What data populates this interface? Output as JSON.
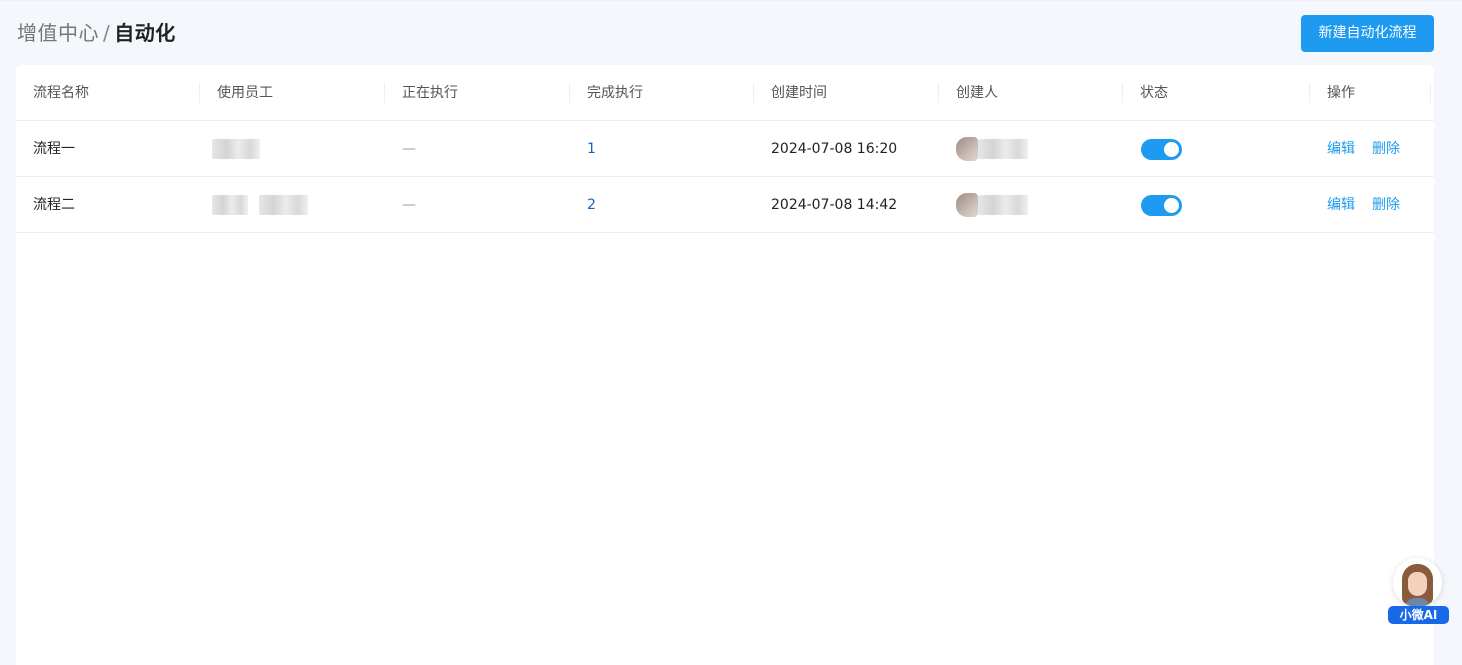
{
  "breadcrumb": {
    "parent": "增值中心",
    "separator": "/",
    "current": "自动化"
  },
  "new_button_label": "新建自动化流程",
  "table": {
    "columns": [
      "流程名称",
      "使用员工",
      "正在执行",
      "完成执行",
      "创建时间",
      "创建人",
      "状态",
      "操作"
    ],
    "rows": [
      {
        "name": "流程一",
        "running": "—",
        "completed": "1",
        "created_at": "2024-07-08 16:20",
        "enabled": true,
        "edit": "编辑",
        "delete": "删除"
      },
      {
        "name": "流程二",
        "running": "—",
        "completed": "2",
        "created_at": "2024-07-08 14:42",
        "enabled": true,
        "edit": "编辑",
        "delete": "删除"
      }
    ]
  },
  "assistant": {
    "label": "小微AI"
  },
  "colors": {
    "accent": "#1e9bf0",
    "link": "#1565c0",
    "background": "#f4f7fb"
  }
}
